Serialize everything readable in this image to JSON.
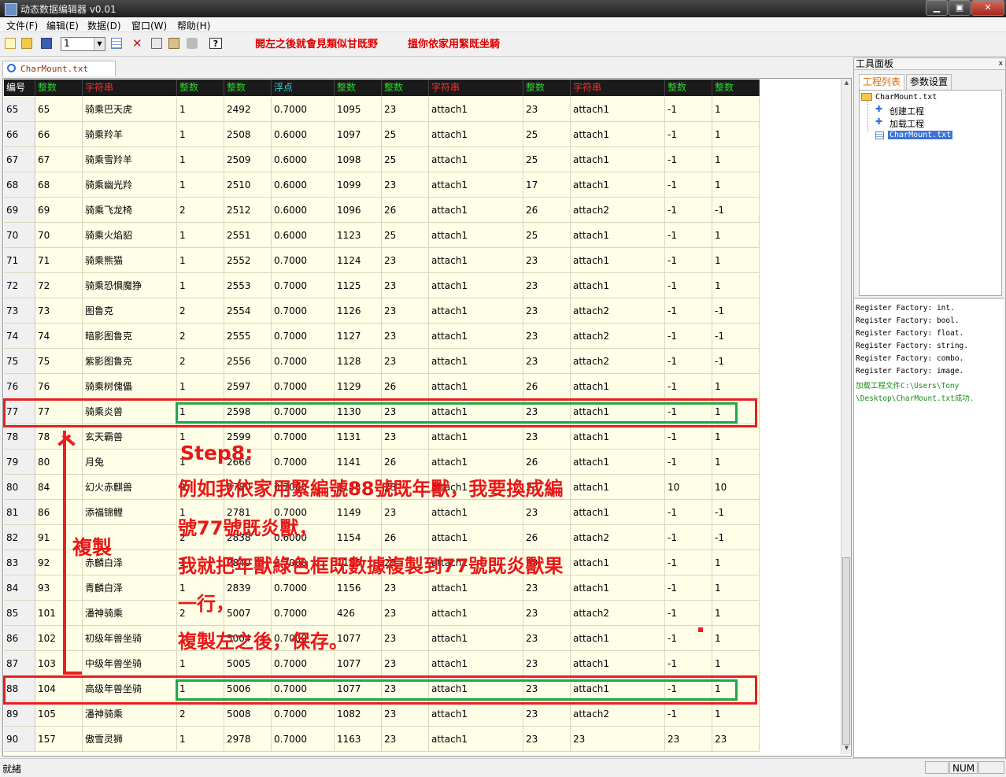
{
  "window": {
    "title": "动态数据编辑器 v0.01",
    "minimize": "▁",
    "maximize": "▣",
    "close": "✕"
  },
  "menu": [
    "文件(F)",
    "编辑(E)",
    "数据(D)",
    "窗口(W)",
    "帮助(H)"
  ],
  "toolbar": {
    "combo_value": "1",
    "help_label": "?",
    "note1": "開左之後就會見類似甘既野",
    "note2": "搵你依家用緊既坐騎"
  },
  "doc_tab": {
    "label": "CharMount.txt"
  },
  "grid": {
    "headers": [
      {
        "label": "编号",
        "kind": "id"
      },
      {
        "label": "整数",
        "kind": "num"
      },
      {
        "label": "字符串",
        "kind": "str"
      },
      {
        "label": "整数",
        "kind": "num"
      },
      {
        "label": "整数",
        "kind": "num"
      },
      {
        "label": "浮点",
        "kind": "flt"
      },
      {
        "label": "整数",
        "kind": "num"
      },
      {
        "label": "整数",
        "kind": "num"
      },
      {
        "label": "字符串",
        "kind": "str"
      },
      {
        "label": "整数",
        "kind": "num"
      },
      {
        "label": "字符串",
        "kind": "str"
      },
      {
        "label": "整数",
        "kind": "num"
      },
      {
        "label": "整数",
        "kind": "num"
      }
    ],
    "rows": [
      [
        "65",
        "65",
        "骑乘巴天虎",
        "1",
        "2492",
        "0.7000",
        "1095",
        "23",
        "attach1",
        "23",
        "attach1",
        "-1",
        "1"
      ],
      [
        "66",
        "66",
        "骑乘羚羊",
        "1",
        "2508",
        "0.6000",
        "1097",
        "25",
        "attach1",
        "25",
        "attach1",
        "-1",
        "1"
      ],
      [
        "67",
        "67",
        "骑乘雪羚羊",
        "1",
        "2509",
        "0.6000",
        "1098",
        "25",
        "attach1",
        "25",
        "attach1",
        "-1",
        "1"
      ],
      [
        "68",
        "68",
        "骑乘幽光羚",
        "1",
        "2510",
        "0.6000",
        "1099",
        "23",
        "attach1",
        "17",
        "attach1",
        "-1",
        "1"
      ],
      [
        "69",
        "69",
        "骑乘飞龙椅",
        "2",
        "2512",
        "0.6000",
        "1096",
        "26",
        "attach1",
        "26",
        "attach2",
        "-1",
        "-1"
      ],
      [
        "70",
        "70",
        "骑乘火焰貂",
        "1",
        "2551",
        "0.6000",
        "1123",
        "25",
        "attach1",
        "25",
        "attach1",
        "-1",
        "1"
      ],
      [
        "71",
        "71",
        "骑乘熊猫",
        "1",
        "2552",
        "0.7000",
        "1124",
        "23",
        "attach1",
        "23",
        "attach1",
        "-1",
        "1"
      ],
      [
        "72",
        "72",
        "骑乘恐惧魔狰",
        "1",
        "2553",
        "0.7000",
        "1125",
        "23",
        "attach1",
        "23",
        "attach1",
        "-1",
        "1"
      ],
      [
        "73",
        "73",
        "图鲁克",
        "2",
        "2554",
        "0.7000",
        "1126",
        "23",
        "attach1",
        "23",
        "attach2",
        "-1",
        "-1"
      ],
      [
        "74",
        "74",
        "暗影图鲁克",
        "2",
        "2555",
        "0.7000",
        "1127",
        "23",
        "attach1",
        "23",
        "attach2",
        "-1",
        "-1"
      ],
      [
        "75",
        "75",
        "紫影图鲁克",
        "2",
        "2556",
        "0.7000",
        "1128",
        "23",
        "attach1",
        "23",
        "attach2",
        "-1",
        "-1"
      ],
      [
        "76",
        "76",
        "骑乘树傀儡",
        "1",
        "2597",
        "0.7000",
        "1129",
        "26",
        "attach1",
        "26",
        "attach1",
        "-1",
        "1"
      ],
      [
        "77",
        "77",
        "骑乘炎兽",
        "1",
        "2598",
        "0.7000",
        "1130",
        "23",
        "attach1",
        "23",
        "attach1",
        "-1",
        "1"
      ],
      [
        "78",
        "78",
        "玄天霸兽",
        "1",
        "2599",
        "0.7000",
        "1131",
        "23",
        "attach1",
        "23",
        "attach1",
        "-1",
        "1"
      ],
      [
        "79",
        "80",
        "月兔",
        "1",
        "2666",
        "0.7000",
        "1141",
        "26",
        "attach1",
        "26",
        "attach1",
        "-1",
        "1"
      ],
      [
        "80",
        "84",
        "幻火赤麒兽",
        "2",
        "2780",
        "0.7000",
        "1148",
        "23",
        "attach1",
        "23",
        "attach1",
        "10",
        "10"
      ],
      [
        "81",
        "86",
        "添福锦鲤",
        "1",
        "2781",
        "0.7000",
        "1149",
        "23",
        "attach1",
        "23",
        "attach1",
        "-1",
        "-1"
      ],
      [
        "82",
        "91",
        "",
        "2",
        "2838",
        "0.6000",
        "1154",
        "26",
        "attach1",
        "26",
        "attach2",
        "-1",
        "-1"
      ],
      [
        "83",
        "92",
        "赤麟白泽",
        "1",
        "2840",
        "0.7000",
        "1155",
        "23",
        "attach1",
        "23",
        "attach1",
        "-1",
        "1"
      ],
      [
        "84",
        "93",
        "青麟白泽",
        "1",
        "2839",
        "0.7000",
        "1156",
        "23",
        "attach1",
        "23",
        "attach1",
        "-1",
        "1"
      ],
      [
        "85",
        "101",
        "潘神骑乘",
        "2",
        "5007",
        "0.7000",
        "426",
        "23",
        "attach1",
        "23",
        "attach2",
        "-1",
        "1"
      ],
      [
        "86",
        "102",
        "初级年兽坐骑",
        "1",
        "5004",
        "0.7000",
        "1077",
        "23",
        "attach1",
        "23",
        "attach1",
        "-1",
        "1"
      ],
      [
        "87",
        "103",
        "中级年兽坐骑",
        "1",
        "5005",
        "0.7000",
        "1077",
        "23",
        "attach1",
        "23",
        "attach1",
        "-1",
        "1"
      ],
      [
        "88",
        "104",
        "高级年兽坐骑",
        "1",
        "5006",
        "0.7000",
        "1077",
        "23",
        "attach1",
        "23",
        "attach1",
        "-1",
        "1"
      ],
      [
        "89",
        "105",
        "潘神骑乘",
        "2",
        "5008",
        "0.7000",
        "1082",
        "23",
        "attach1",
        "23",
        "attach2",
        "-1",
        "1"
      ],
      [
        "90",
        "157",
        "傲雪灵狮",
        "1",
        "2978",
        "0.7000",
        "1163",
        "23",
        "attach1",
        "23",
        "23",
        "23",
        "23"
      ]
    ]
  },
  "annotations": {
    "copy_label": "複製",
    "step_title": "Step8:",
    "lines": [
      "例如我依家用緊編號88號既年獸，我要換成編",
      "號77號既炎獸，",
      "我就把年獸綠色框既數據複製到77號既炎獸果",
      "一行，",
      "複製左之後，保存。"
    ]
  },
  "panel": {
    "title": "工具面板",
    "close": "x",
    "tabs": [
      "工程列表",
      "参数设置"
    ],
    "tree": {
      "root": "CharMount.txt",
      "items": [
        "创建工程",
        "加载工程"
      ],
      "file": "CharMount.txt"
    },
    "log": [
      "Register Factory: int.",
      "Register Factory: bool.",
      "Register Factory: float.",
      "Register Factory: string.",
      "Register Factory: combo.",
      "Register Factory: image."
    ],
    "log_success": [
      "加载工程文件C:\\Users\\Tony",
      "\\Desktop\\CharMount.txt成功."
    ]
  },
  "status": {
    "text": "就緒",
    "num": "NUM"
  }
}
